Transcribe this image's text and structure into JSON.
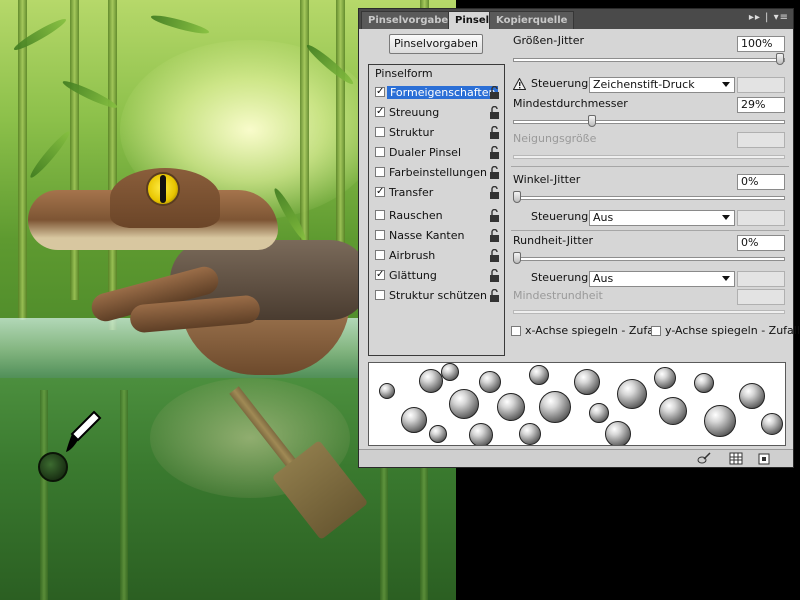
{
  "panel": {
    "tabs": [
      {
        "label": "Pinselvorgaben",
        "active": false
      },
      {
        "label": "Pinsel",
        "active": true
      },
      {
        "label": "Kopierquelle",
        "active": false
      }
    ],
    "menu_glyph": "▸▸ | ▾≡",
    "presets_button": "Pinselvorgaben",
    "option_list": {
      "header": "Pinselform",
      "items": [
        {
          "label": "Formeigenschaften",
          "checked": true,
          "selected": true
        },
        {
          "label": "Streuung",
          "checked": true,
          "selected": false
        },
        {
          "label": "Struktur",
          "checked": false,
          "selected": false
        },
        {
          "label": "Dualer Pinsel",
          "checked": false,
          "selected": false
        },
        {
          "label": "Farbeinstellungen",
          "checked": false,
          "selected": false
        },
        {
          "label": "Transfer",
          "checked": true,
          "selected": false
        },
        {
          "label": "Rauschen",
          "checked": false,
          "selected": false
        },
        {
          "label": "Nasse Kanten",
          "checked": false,
          "selected": false
        },
        {
          "label": "Airbrush",
          "checked": false,
          "selected": false
        },
        {
          "label": "Glättung",
          "checked": true,
          "selected": false
        },
        {
          "label": "Struktur schützen",
          "checked": false,
          "selected": false
        }
      ]
    },
    "settings": {
      "size_jitter_label": "Größen-Jitter",
      "size_jitter_value": "100%",
      "size_jitter_fraction": 1.0,
      "control1_label": "Steuerung:",
      "control1_value": "Zeichenstift-Druck",
      "min_diameter_label": "Mindestdurchmesser",
      "min_diameter_value": "29%",
      "min_diameter_fraction": 0.29,
      "tilt_scale_label": "Neigungsgröße",
      "angle_jitter_label": "Winkel-Jitter",
      "angle_jitter_value": "0%",
      "angle_jitter_fraction": 0.0,
      "control2_label": "Steuerung:",
      "control2_value": "Aus",
      "roundness_jitter_label": "Rundheit-Jitter",
      "roundness_jitter_value": "0%",
      "roundness_jitter_fraction": 0.0,
      "control3_label": "Steuerung:",
      "control3_value": "Aus",
      "min_roundness_label": "Mindestrundheit",
      "flip_x_label": "x-Achse spiegeln - Zufall",
      "flip_y_label": "y-Achse spiegeln - Zufall",
      "flip_x_checked": false,
      "flip_y_checked": false
    }
  },
  "icons": {
    "warning": "warning-icon",
    "lock": "lock-icon",
    "brush": "brush-icon",
    "grid": "grid-icon",
    "new": "new-preset-icon"
  },
  "colors": {
    "selection": "#2b6fd6",
    "panel_bg": "#d6d6d6",
    "tabbar_bg": "#4a4a4a"
  }
}
